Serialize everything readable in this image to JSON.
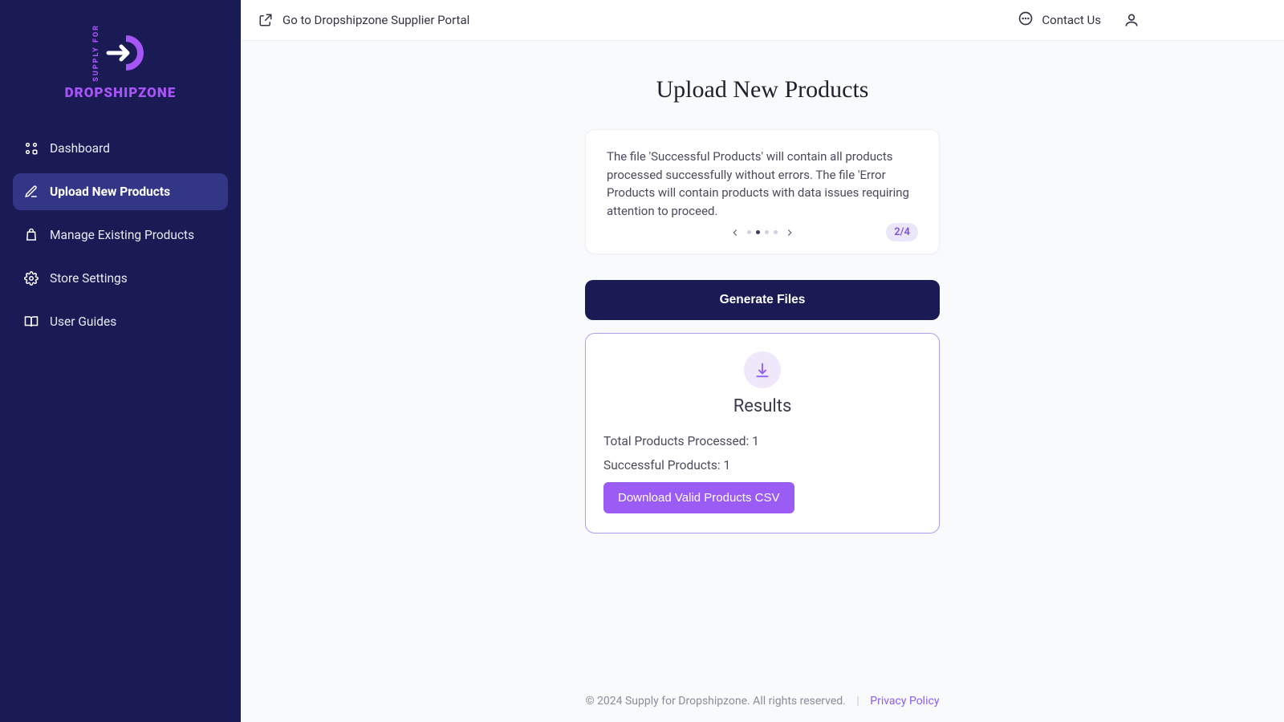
{
  "brand": {
    "supply": "SUPPLY FOR",
    "name": "DROPSHIPZONE"
  },
  "sidebar": {
    "items": [
      {
        "label": "Dashboard"
      },
      {
        "label": "Upload New Products"
      },
      {
        "label": "Manage Existing Products"
      },
      {
        "label": "Store Settings"
      },
      {
        "label": "User Guides"
      }
    ]
  },
  "topbar": {
    "portal_link": "Go to Dropshipzone Supplier Portal",
    "contact": "Contact Us"
  },
  "page": {
    "title": "Upload New Products"
  },
  "info": {
    "text": "The file 'Successful Products' will contain all products processed successfully without errors. The file 'Error Products will contain products with data issues requiring attention to proceed.",
    "step": "2/4",
    "active_dot": 1,
    "dot_count": 4
  },
  "actions": {
    "generate": "Generate Files",
    "download": "Download Valid Products CSV"
  },
  "results": {
    "title": "Results",
    "total_label": "Total Products Processed: ",
    "total_value": "1",
    "success_label": "Successful Products: ",
    "success_value": "1"
  },
  "footer": {
    "copyright": "© 2024 Supply for Dropshipzone. All rights reserved.",
    "sep": "|",
    "privacy": "Privacy Policy"
  }
}
